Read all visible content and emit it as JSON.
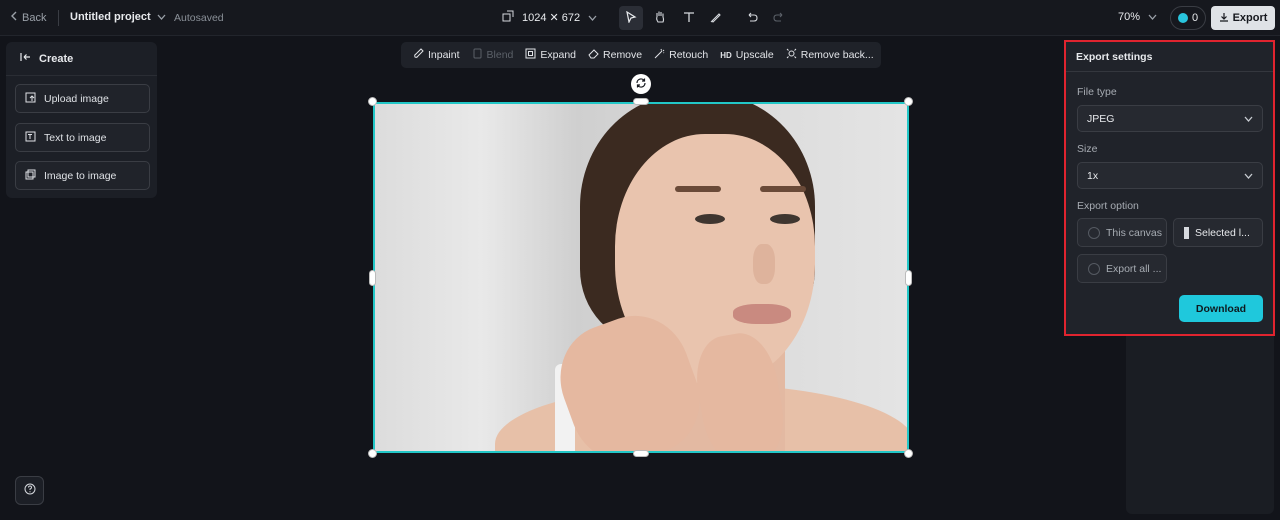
{
  "topbar": {
    "back_label": "Back",
    "project_title": "Untitled project",
    "status": "Autosaved",
    "canvas_size": "1024 ✕ 672",
    "zoom": "70%",
    "credits": "0",
    "export_label": "Export"
  },
  "left_panel": {
    "title": "Create",
    "items": [
      {
        "label": "Upload image",
        "icon": "upload-image-icon"
      },
      {
        "label": "Text to image",
        "icon": "text-to-image-icon"
      },
      {
        "label": "Image to image",
        "icon": "image-to-image-icon"
      }
    ]
  },
  "edit_toolbar": {
    "items": [
      {
        "label": "Inpaint",
        "icon": "brush-icon",
        "disabled": false
      },
      {
        "label": "Blend",
        "icon": "blend-icon",
        "disabled": true
      },
      {
        "label": "Expand",
        "icon": "expand-icon",
        "disabled": false
      },
      {
        "label": "Remove",
        "icon": "eraser-icon",
        "disabled": false
      },
      {
        "label": "Retouch",
        "icon": "retouch-icon",
        "disabled": false
      },
      {
        "label": "Upscale",
        "icon": "hd-icon",
        "disabled": false
      },
      {
        "label": "Remove back...",
        "icon": "remove-background-icon",
        "disabled": false
      }
    ]
  },
  "export_settings": {
    "title": "Export settings",
    "file_type_label": "File type",
    "file_type_value": "JPEG",
    "size_label": "Size",
    "size_value": "1x",
    "export_option_label": "Export option",
    "options": [
      {
        "label": "This canvas",
        "selected": false
      },
      {
        "label": "Selected l...",
        "selected": true
      },
      {
        "label": "Export all ...",
        "selected": false
      }
    ],
    "download_label": "Download"
  },
  "colors": {
    "accent": "#1fc8dc",
    "selection": "#22c7c7",
    "highlight": "#e0242f",
    "background": "#12141a"
  }
}
